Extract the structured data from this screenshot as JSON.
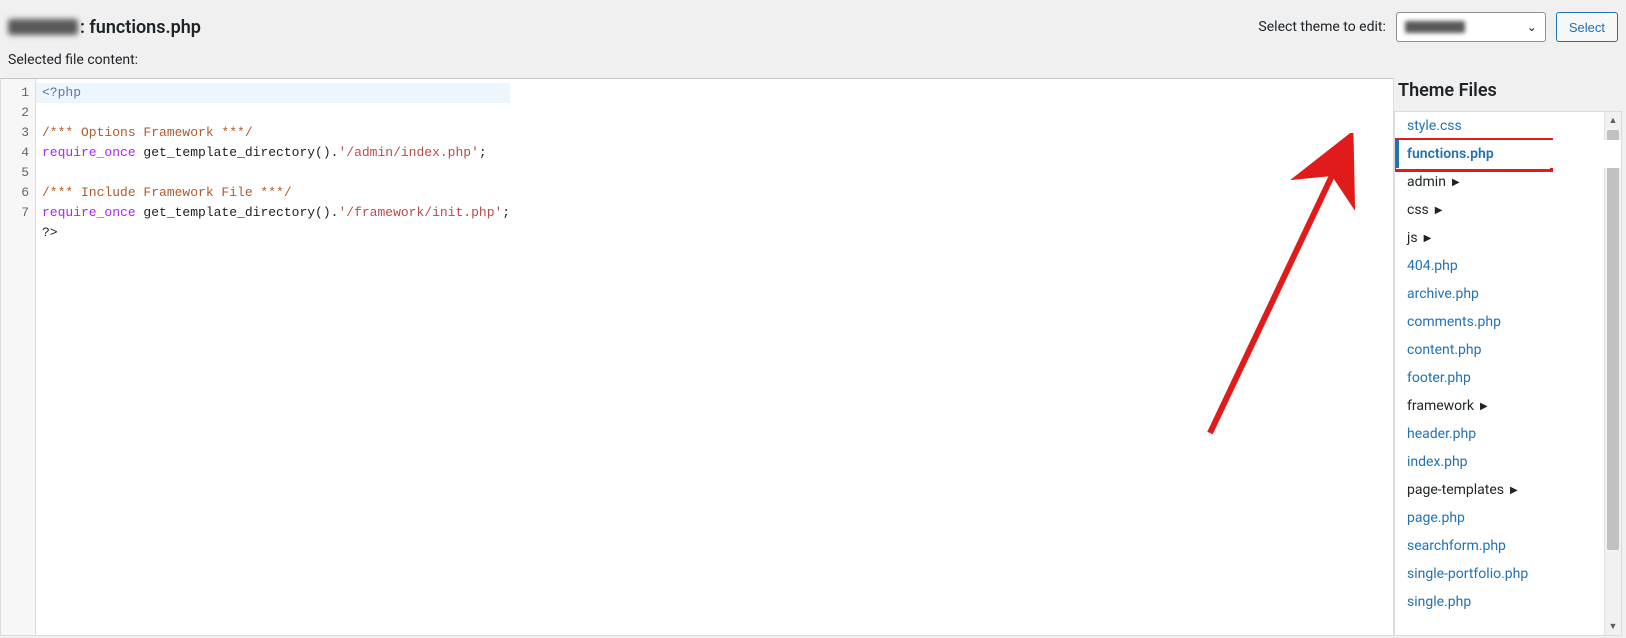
{
  "header": {
    "theme_name_blurred": true,
    "title_file": "functions.php",
    "select_label": "Select theme to edit:",
    "selected_theme_blurred": true,
    "select_button": "Select"
  },
  "subtitle": "Selected file content:",
  "code": {
    "lines": [
      {
        "n": 1,
        "segs": [
          {
            "cls": "php",
            "t": "<?php"
          }
        ],
        "hl": true
      },
      {
        "n": 2,
        "segs": [
          {
            "cls": "cm",
            "t": "/*** Options Framework ***/"
          }
        ]
      },
      {
        "n": 3,
        "segs": [
          {
            "cls": "kw",
            "t": "require_once "
          },
          {
            "cls": "fn",
            "t": "get_template_directory()."
          },
          {
            "cls": "str",
            "t": "'/admin/index.php'"
          },
          {
            "cls": "txt",
            "t": ";"
          }
        ]
      },
      {
        "n": 4,
        "segs": []
      },
      {
        "n": 5,
        "segs": [
          {
            "cls": "cm",
            "t": "/*** Include Framework File ***/"
          }
        ]
      },
      {
        "n": 6,
        "segs": [
          {
            "cls": "kw",
            "t": "require_once "
          },
          {
            "cls": "fn",
            "t": "get_template_directory()."
          },
          {
            "cls": "str",
            "t": "'/framework/init.php'"
          },
          {
            "cls": "txt",
            "t": ";"
          }
        ]
      },
      {
        "n": 7,
        "segs": [
          {
            "cls": "txt",
            "t": "?>"
          }
        ]
      }
    ]
  },
  "sidebar": {
    "heading": "Theme Files",
    "items": [
      {
        "label": "style.css",
        "type": "file",
        "active": false
      },
      {
        "label": "functions.php",
        "type": "file",
        "active": true
      },
      {
        "label": "admin",
        "type": "folder",
        "active": false
      },
      {
        "label": "css",
        "type": "folder",
        "active": false
      },
      {
        "label": "js",
        "type": "folder",
        "active": false
      },
      {
        "label": "404.php",
        "type": "file",
        "active": false
      },
      {
        "label": "archive.php",
        "type": "file",
        "active": false
      },
      {
        "label": "comments.php",
        "type": "file",
        "active": false
      },
      {
        "label": "content.php",
        "type": "file",
        "active": false
      },
      {
        "label": "footer.php",
        "type": "file",
        "active": false
      },
      {
        "label": "framework",
        "type": "folder",
        "active": false
      },
      {
        "label": "header.php",
        "type": "file",
        "active": false
      },
      {
        "label": "index.php",
        "type": "file",
        "active": false
      },
      {
        "label": "page-templates",
        "type": "folder",
        "active": false
      },
      {
        "label": "page.php",
        "type": "file",
        "active": false
      },
      {
        "label": "searchform.php",
        "type": "file",
        "active": false
      },
      {
        "label": "single-portfolio.php",
        "type": "file",
        "active": false
      },
      {
        "label": "single.php",
        "type": "file",
        "active": false
      }
    ]
  }
}
